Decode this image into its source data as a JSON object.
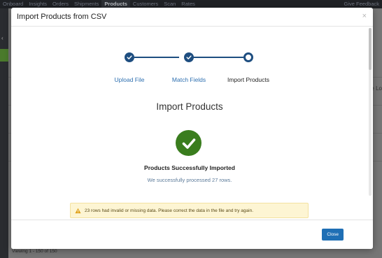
{
  "topnav": {
    "items": [
      "Onboard",
      "Insights",
      "Orders",
      "Shipments",
      "Products",
      "Customers",
      "Scan",
      "Rates"
    ],
    "active_index": 4,
    "feedback": "Give Feedback"
  },
  "background": {
    "side_text": "e Lo",
    "footer_text": "Viewing 1 - 150 of 150"
  },
  "modal": {
    "title": "Import Products from CSV",
    "close_symbol": "×",
    "steps": [
      {
        "label": "Upload File",
        "state": "done"
      },
      {
        "label": "Match Fields",
        "state": "done"
      },
      {
        "label": "Import Products",
        "state": "current"
      }
    ],
    "heading": "Import Products",
    "success_title": "Products Successfully Imported",
    "success_subtitle": "We successfully processed 27 rows.",
    "warning": "23 rows had invalid or missing data. Please correct the data in the file and try again.",
    "close_button": "Close"
  },
  "colors": {
    "primary": "#1e4e80",
    "link": "#2d6fb0",
    "success": "#3a7d1e",
    "warning_bg": "#fdf5d3",
    "button": "#1f6fb5"
  }
}
